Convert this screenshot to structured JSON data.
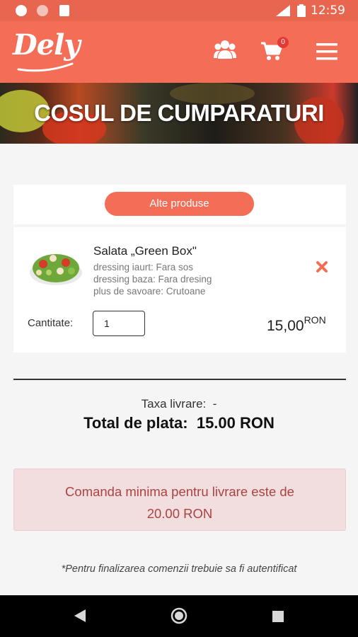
{
  "status_bar": {
    "time": "12:59"
  },
  "header": {
    "logo": "Dely",
    "cart_count": "0"
  },
  "hero": {
    "title": "COSUL DE CUMPARATURI"
  },
  "cart": {
    "other_products_label": "Alte produse",
    "item": {
      "name": "Salata „Green Box\"",
      "options": [
        "dressing iaurt: Fara sos",
        "dressing baza: Fara dresing",
        "plus de savoare: Crutoane"
      ],
      "quantity_label": "Cantitate:",
      "quantity": "1",
      "price": "15,00",
      "currency": "RON"
    }
  },
  "summary": {
    "delivery_label": "Taxa livrare:",
    "delivery_value": "-",
    "total_label": "Total de plata:",
    "total_value": "15.00 RON"
  },
  "alert": {
    "line1": "Comanda minima pentru livrare este de",
    "line2": "20.00 RON"
  },
  "footnote": "*Pentru finalizarea comenzii trebuie sa fi autentificat",
  "icons": {
    "users": "users-icon",
    "cart": "cart-icon",
    "menu": "menu-icon",
    "remove": "close-icon",
    "back": "back-icon",
    "home": "home-icon",
    "recents": "recents-icon"
  },
  "colors": {
    "brand": "#f46d56",
    "alert_bg": "#f2dede",
    "alert_text": "#a94442"
  }
}
